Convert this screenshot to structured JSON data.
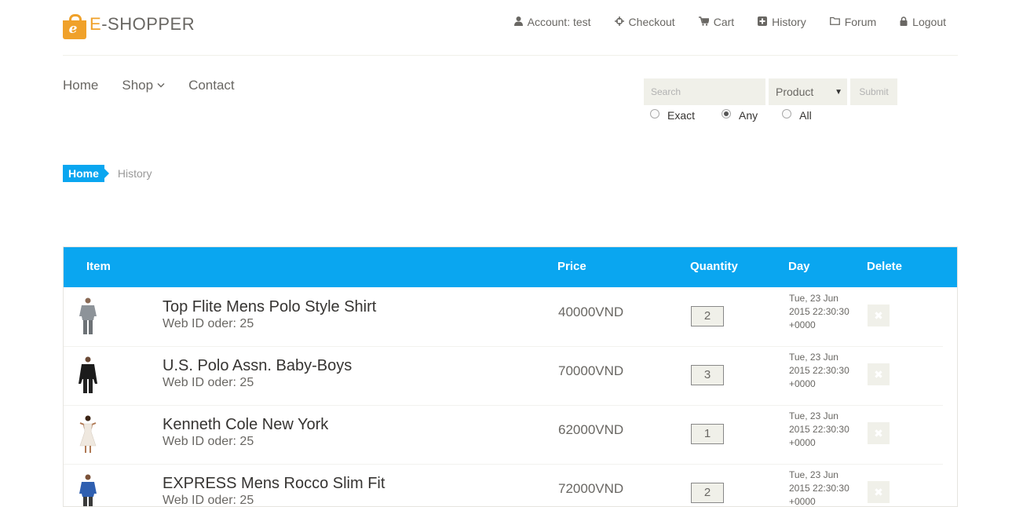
{
  "logo": {
    "first_letter": "E",
    "rest": "-SHOPPER",
    "bag_letter": "e"
  },
  "account_nav": [
    {
      "label": "Account: test",
      "icon": "user-icon"
    },
    {
      "label": "Checkout",
      "icon": "crosshairs-icon"
    },
    {
      "label": "Cart",
      "icon": "cart-icon"
    },
    {
      "label": "History",
      "icon": "plus-square-icon"
    },
    {
      "label": "Forum",
      "icon": "folder-icon"
    },
    {
      "label": "Logout",
      "icon": "lock-icon"
    }
  ],
  "main_nav": {
    "home": "Home",
    "shop": "Shop",
    "contact": "Contact"
  },
  "search": {
    "placeholder": "Search",
    "select_value": "Product",
    "submit": "Submit",
    "radios": [
      {
        "label": "Exact",
        "checked": false
      },
      {
        "label": "Any",
        "checked": true
      },
      {
        "label": "All",
        "checked": false
      }
    ]
  },
  "breadcrumb": {
    "home": "Home",
    "current": "History"
  },
  "table": {
    "headers": {
      "item": "Item",
      "price": "Price",
      "quantity": "Quantity",
      "day": "Day",
      "delete": "Delete"
    },
    "rows": [
      {
        "title": "Top Flite Mens Polo Style Shirt",
        "webid": "Web ID oder: 25",
        "price": "40000VND",
        "qty": "2",
        "day": "Tue, 23 Jun 2015 22:30:30 +0000"
      },
      {
        "title": "U.S. Polo Assn. Baby-Boys",
        "webid": "Web ID oder: 25",
        "price": "70000VND",
        "qty": "3",
        "day": "Tue, 23 Jun 2015 22:30:30 +0000"
      },
      {
        "title": "Kenneth Cole New York",
        "webid": "Web ID oder: 25",
        "price": "62000VND",
        "qty": "1",
        "day": "Tue, 23 Jun 2015 22:30:30 +0000"
      },
      {
        "title": "EXPRESS Mens Rocco Slim Fit",
        "webid": "Web ID oder: 25",
        "price": "72000VND",
        "qty": "2",
        "day": "Tue, 23 Jun 2015 22:30:30 +0000"
      }
    ]
  },
  "colors": {
    "accent": "#0aa6f0",
    "brand": "#f0a12a",
    "text": "#696763",
    "field_bg": "#f0f0e9"
  }
}
